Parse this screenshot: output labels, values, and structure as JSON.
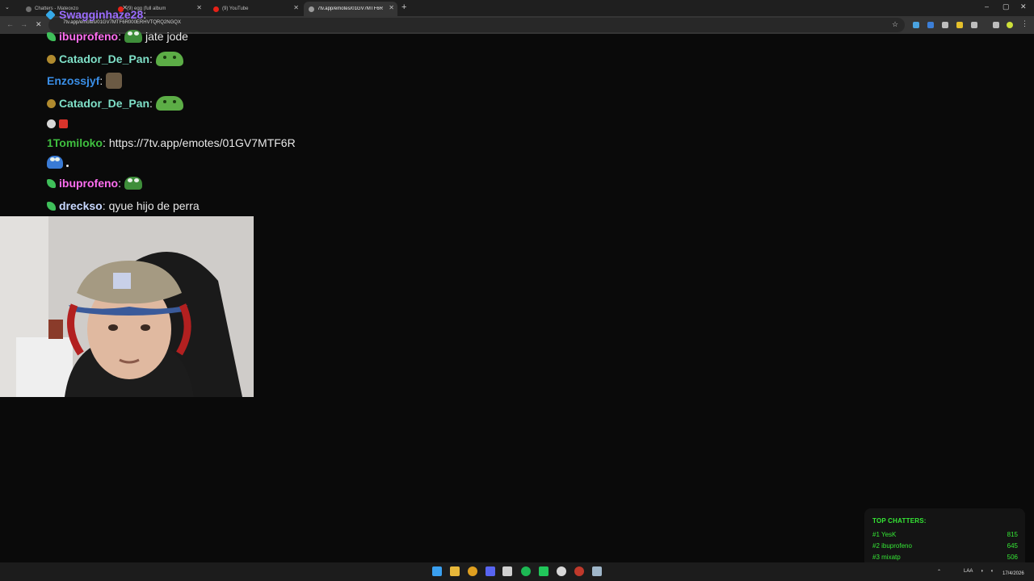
{
  "browser": {
    "tabs": [
      {
        "title": "Chatters - Mateoxzo",
        "active": false
      },
      {
        "title": "(9) egg (full album",
        "active": false
      },
      {
        "title": "(9) YouTube",
        "active": false
      },
      {
        "title": "7tv.app/emotes/01GV7MTF6R",
        "active": true
      }
    ],
    "new_tab": "+",
    "url": "7tv.app/emotes/01GV7MTF6R000ERHVTQRQ2NGQX"
  },
  "chat": {
    "messages": [
      {
        "user": "Swagginhaze28",
        "user_color": "#9b6cff",
        "text": ""
      },
      {
        "user": "ibuprofeno",
        "user_color": "#ff6ef0",
        "text": "jate jode"
      },
      {
        "user": "Catador_De_Pan",
        "user_color": "#7fe0c8",
        "text": ""
      },
      {
        "user": "Enzossjyf",
        "user_color": "#3a8fe8",
        "text": ""
      },
      {
        "user": "Catador_De_Pan",
        "user_color": "#7fe0c8",
        "text": ""
      },
      {
        "user": "1Tomiloko",
        "user_color": "#3fbf3f",
        "text": "https://7tv.app/emotes/01GV7MTF6R"
      },
      {
        "user": "ibuprofeno",
        "user_color": "#ff6ef0",
        "text": ""
      },
      {
        "user": "drecksо",
        "user_color": "#c8d8ff",
        "text": "qyue hijo de perra"
      }
    ]
  },
  "top_chatters": {
    "title": "TOP CHATTERS:",
    "accent": "#35e835",
    "rows": [
      {
        "rank": "#1 YesK",
        "count": "815"
      },
      {
        "rank": "#2 ibuprofeno",
        "count": "645"
      },
      {
        "rank": "#3 mixatp",
        "count": "506"
      }
    ]
  },
  "taskbar": {
    "language": "LAA",
    "date": "17/4/2026"
  }
}
